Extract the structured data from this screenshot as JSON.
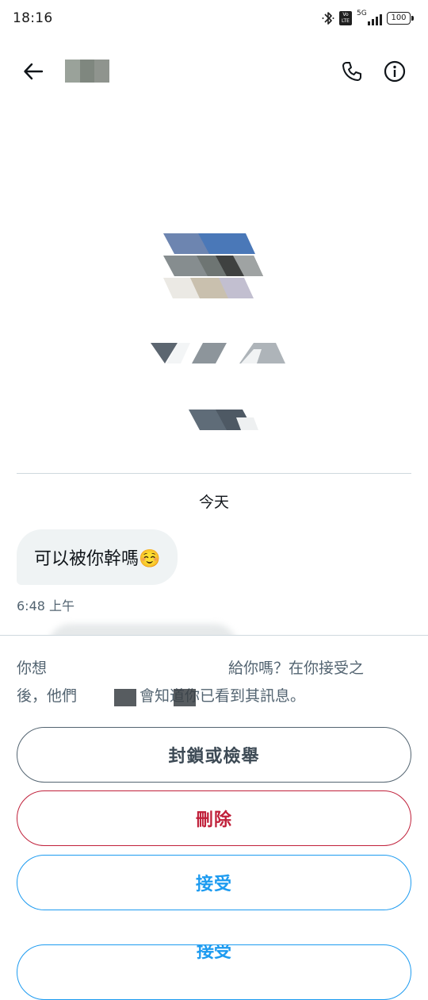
{
  "status_bar": {
    "time": "18:16",
    "network_label": "5G",
    "volte_label": "Vo LTE",
    "battery": "100",
    "icons": [
      "bluetooth-icon",
      "volte-icon",
      "signal-icon",
      "battery-icon"
    ]
  },
  "header": {
    "back_icon": "arrow-left-icon",
    "call_icon": "phone-icon",
    "info_icon": "info-circle-icon"
  },
  "conversation": {
    "date_divider": "今天",
    "messages": [
      {
        "text": "可以被你幹嗎☺️",
        "time": "6:48 上午"
      }
    ]
  },
  "message_request": {
    "line1_start": "你想",
    "line1_end": "給你嗎？在你接受之",
    "line2_start": "後，他們",
    "line2_mid": "會知道你已看到其訊息。",
    "buttons": {
      "block": "封鎖或檢舉",
      "delete": "刪除",
      "accept": "接受",
      "partial": "接受"
    }
  },
  "colors": {
    "accent": "#1d9bf0",
    "danger": "#c0203a",
    "secondary_text": "#536471",
    "bubble_bg": "#eff3f4",
    "divider": "#cfd9de"
  }
}
